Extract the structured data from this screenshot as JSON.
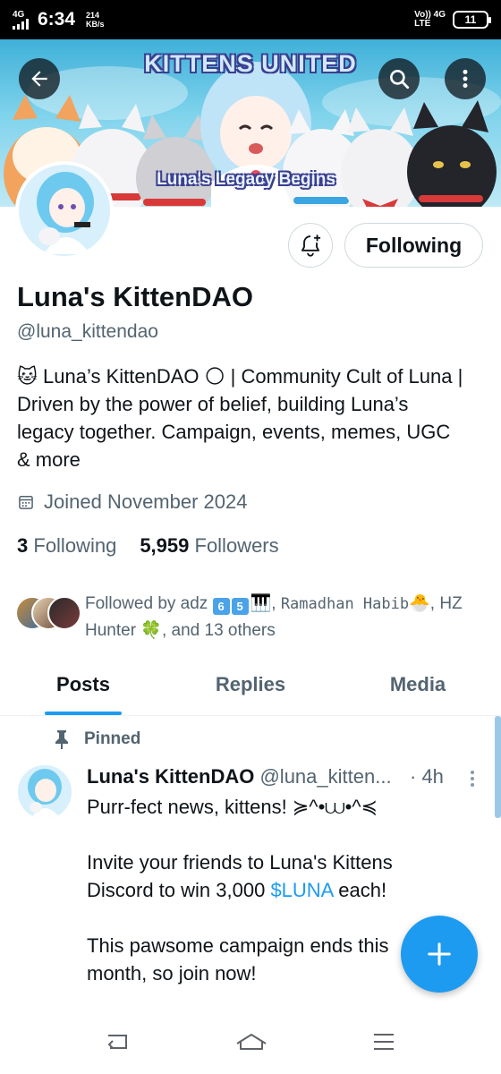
{
  "status_bar": {
    "network_top": "4G",
    "time": "6:34",
    "speed_value": "214",
    "speed_unit": "KB/s",
    "volte_top": "Vo)) 4G",
    "volte_bottom": "LTE",
    "battery": "11"
  },
  "banner": {
    "title": "KITTENS UNITED",
    "subtitle": "Luna's Legacy Begins"
  },
  "actions": {
    "following_label": "Following"
  },
  "profile": {
    "display_name": "Luna's KittenDAO",
    "handle": "@luna_kittendao",
    "bio": "🐱 Luna’s KittenDAO 🌕 | Community Cult of Luna | Driven by the power of belief, building Luna’s legacy together. Campaign, events, memes, UGC & more",
    "joined": "Joined November 2024",
    "following_count": "3",
    "following_label": "Following",
    "followers_count": "5,959",
    "followers_label": "Followers"
  },
  "followed_by": {
    "prefix": "Followed by adz",
    "emoji_6": "6",
    "emoji_5": "5",
    "piano": "🎹",
    "sep1": ",",
    "name2": "Ramadhan Habib",
    "chick": "🐣",
    "sep2": ",",
    "name3": "HZ Hunter",
    "clover": "🍀",
    "suffix": ", and 13 others"
  },
  "tabs": [
    {
      "label": "Posts"
    },
    {
      "label": "Replies"
    },
    {
      "label": "Media"
    }
  ],
  "post": {
    "pinned_label": "Pinned",
    "author_name": "Luna's KittenDAO",
    "author_handle": "@luna_kitten...",
    "time": "· 4h",
    "line1": "Purr-fect news, kittens! ≽^•⩊•^≼",
    "line2_pre": "Invite your friends to Luna's Kittens Discord to win 3,000 ",
    "cashtag": "$LUNA",
    "line2_post": " each!",
    "line3": "This pawsome campaign ends this month, so join now!"
  },
  "colors": {
    "accent": "#1d9bf0",
    "text_primary": "#0f1419",
    "text_secondary": "#536471"
  }
}
